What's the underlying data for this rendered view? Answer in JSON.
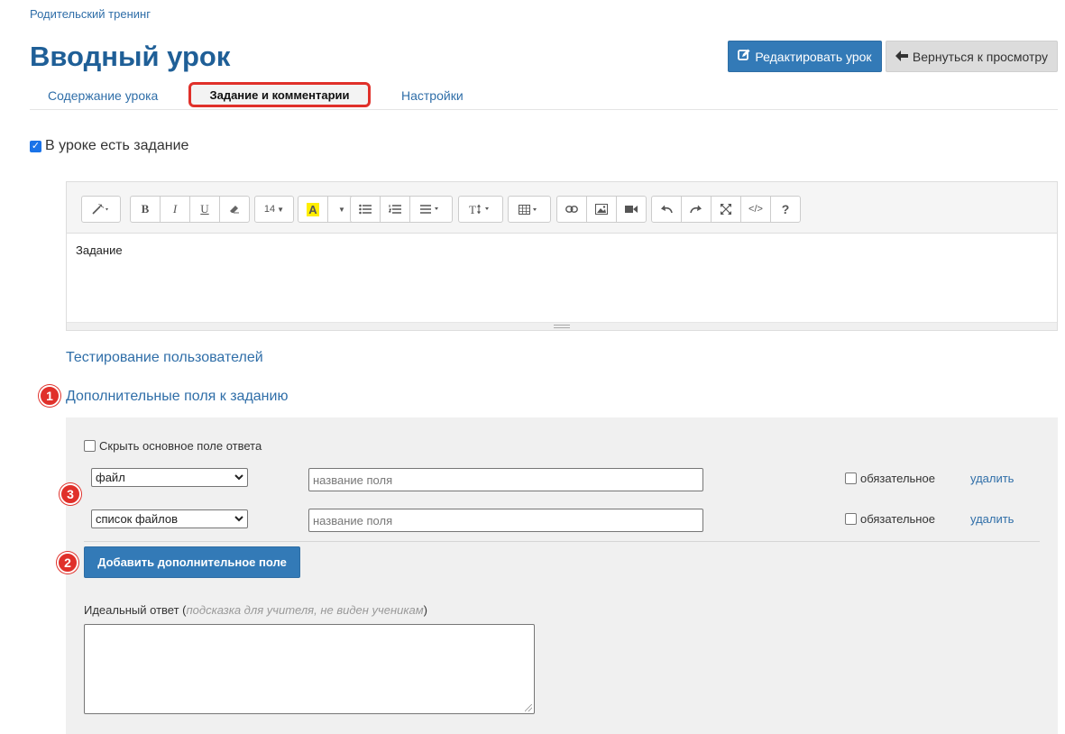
{
  "breadcrumb": "Родительский тренинг",
  "page_title": "Вводный урок",
  "buttons": {
    "edit_lesson": "Редактировать урок",
    "back_to_view": "Вернуться к просмотру",
    "add_field": "Добавить дополнительное поле"
  },
  "tabs": [
    {
      "label": "Содержание урока"
    },
    {
      "label": "Задание и комментарии",
      "active": true
    },
    {
      "label": "Настройки"
    }
  ],
  "has_task": {
    "label": "В уроке есть задание",
    "checked": true
  },
  "editor": {
    "font_size": "14",
    "content": "Задание"
  },
  "links": {
    "testing": "Тестирование пользователей",
    "extra_fields": "Дополнительные поля к заданию"
  },
  "badges": [
    "1",
    "2",
    "3"
  ],
  "hide_main": {
    "label": "Скрыть основное поле ответа",
    "checked": false
  },
  "fields": [
    {
      "type": "файл",
      "placeholder": "название поля",
      "required_label": "обязательное",
      "delete_label": "удалить"
    },
    {
      "type": "список файлов",
      "placeholder": "название поля",
      "required_label": "обязательное",
      "delete_label": "удалить"
    }
  ],
  "ideal_answer": {
    "label": "Идеальный ответ (",
    "hint": "подсказка для учителя, не виден ученикам",
    "close": ")"
  },
  "colors": {
    "accent": "#337ab7",
    "title": "#1f5f97",
    "link": "#2f6ea8",
    "highlight": "#e0302a"
  }
}
